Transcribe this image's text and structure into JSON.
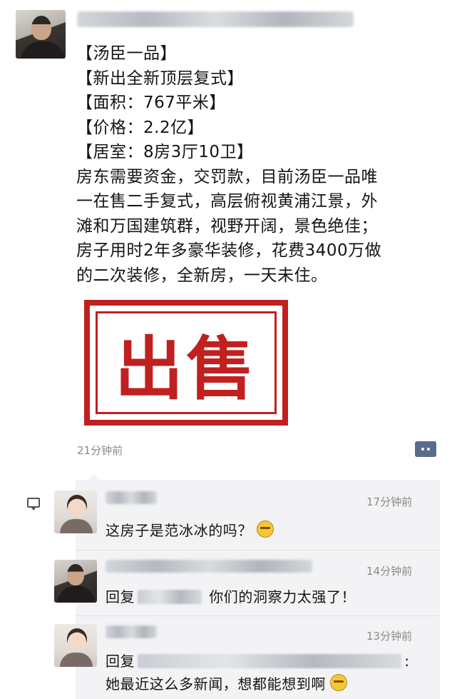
{
  "post": {
    "lines": [
      "【汤臣一品】",
      "【新出全新顶层复式】",
      "【面积：767平米】",
      "【价格：2.2亿】",
      "【居室：8房3厅10卫】",
      "房东需要资金，交罚款，目前汤臣一品唯",
      "一在售二手复式，高层俯视黄浦江景，外",
      "滩和万国建筑群，视野开阔，景色绝佳；",
      "房子用时2年多豪华装修，花费3400万做",
      "的二次装修，全新房，一天未住。"
    ],
    "stamp_text": "出售",
    "time": "21分钟前"
  },
  "comments": [
    {
      "time": "17分钟前",
      "text": "这房子是范冰冰的吗？"
    },
    {
      "time": "14分钟前",
      "reply_prefix": "回复",
      "text": "你们的洞察力太强了！"
    },
    {
      "time": "13分钟前",
      "reply_prefix": "回复",
      "text_suffix": ":",
      "text": "她最近这么多新闻，想都能想到啊"
    }
  ],
  "icons": {
    "more": "more-dots-icon",
    "comment": "comment-bubble-icon",
    "emoji": "grimace-emoji-icon"
  },
  "colors": {
    "stamp_red": "#c0201f",
    "more_button": "#5b6b8c",
    "comment_bg": "#f3f3f5"
  }
}
